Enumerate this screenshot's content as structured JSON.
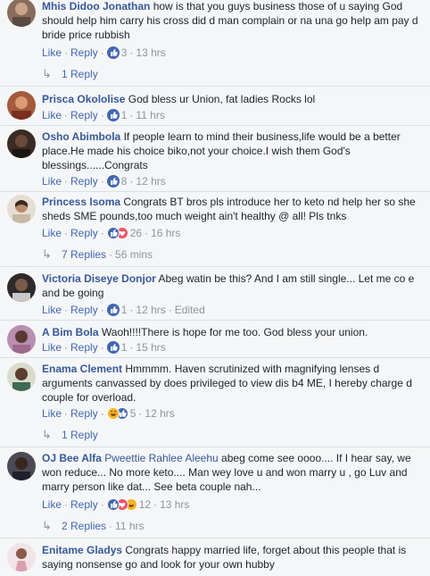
{
  "comments": [
    {
      "author": "Mhis Didoo Jonathan",
      "text": "how is that you guys business those of u saying God should help him carry his cross did d man complain or na una go help am pay d bride price rubbish",
      "like": "Like",
      "reply": "Reply",
      "reaction_count": "3",
      "time": "13 hrs",
      "replies": "1 Reply",
      "avatar_color": "#8a6c5c"
    },
    {
      "author": "Prisca Okololise",
      "text": "God bless ur Union, fat ladies Rocks lol",
      "like": "Like",
      "reply": "Reply",
      "reaction_count": "1",
      "time": "11 hrs",
      "avatar_color": "#a45a3c"
    },
    {
      "author": "Osho Abimbola",
      "text": "If people learn to mind their business,life would be a better place.He made his choice biko,not your choice.I wish them God's blessings......Congrats",
      "like": "Like",
      "reply": "Reply",
      "reaction_count": "8",
      "time": "12 hrs",
      "avatar_color": "#3a2b24"
    },
    {
      "author": "Princess Isoma",
      "text": "Congrats BT bros pls introduce her to keto nd help her so she sheds SME pounds,too much weight ain't healthy @ all! Pls tnks",
      "like": "Like",
      "reply": "Reply",
      "reaction_count": "26",
      "time": "16 hrs",
      "replies": "7 Replies",
      "replies_time": "56 mins",
      "avatar_color": "#c7b8a5"
    },
    {
      "author": "Victoria Diseye Donjor",
      "text": "Abeg watin be this? And I am still single... Let me co e and be going",
      "like": "Like",
      "reply": "Reply",
      "reaction_count": "1",
      "time": "12 hrs",
      "edited": "Edited",
      "avatar_color": "#2e2a2a"
    },
    {
      "author": "A Bim Bola",
      "text": "Waoh!!!!There is hope for me too. God bless your union.",
      "like": "Like",
      "reply": "Reply",
      "reaction_count": "1",
      "time": "15 hrs",
      "avatar_color": "#9c6a8e"
    },
    {
      "author": "Enama Clement",
      "text": "Hmmmm. Haven scrutinized with magnifying lenses d arguments canvassed by does privileged to view dis b4 ME, I hereby charge d couple for overload.",
      "like": "Like",
      "reply": "Reply",
      "reaction_count": "5",
      "time": "12 hrs",
      "replies": "1 Reply",
      "avatar_color": "#6b7a5e"
    },
    {
      "author": "OJ Bee Alfa",
      "tagged": "Pweettie Rahlee Aleehu",
      "text": "abeg come see oooo.... If I hear say, we won reduce... No more keto.... Man wey love u and won marry u , go Luv and marry person like dat... See beta couple nah...",
      "like": "Like",
      "reply": "Reply",
      "reaction_count": "12",
      "time": "13 hrs",
      "replies": "2 Replies",
      "replies_time": "11 hrs",
      "avatar_color": "#4b4a55"
    },
    {
      "author": "Enitame Gladys",
      "text": "Congrats happy married life, forget about this people that is saying nonsense go and look for your own hubby",
      "avatar_color": "#d9a0b0"
    }
  ]
}
